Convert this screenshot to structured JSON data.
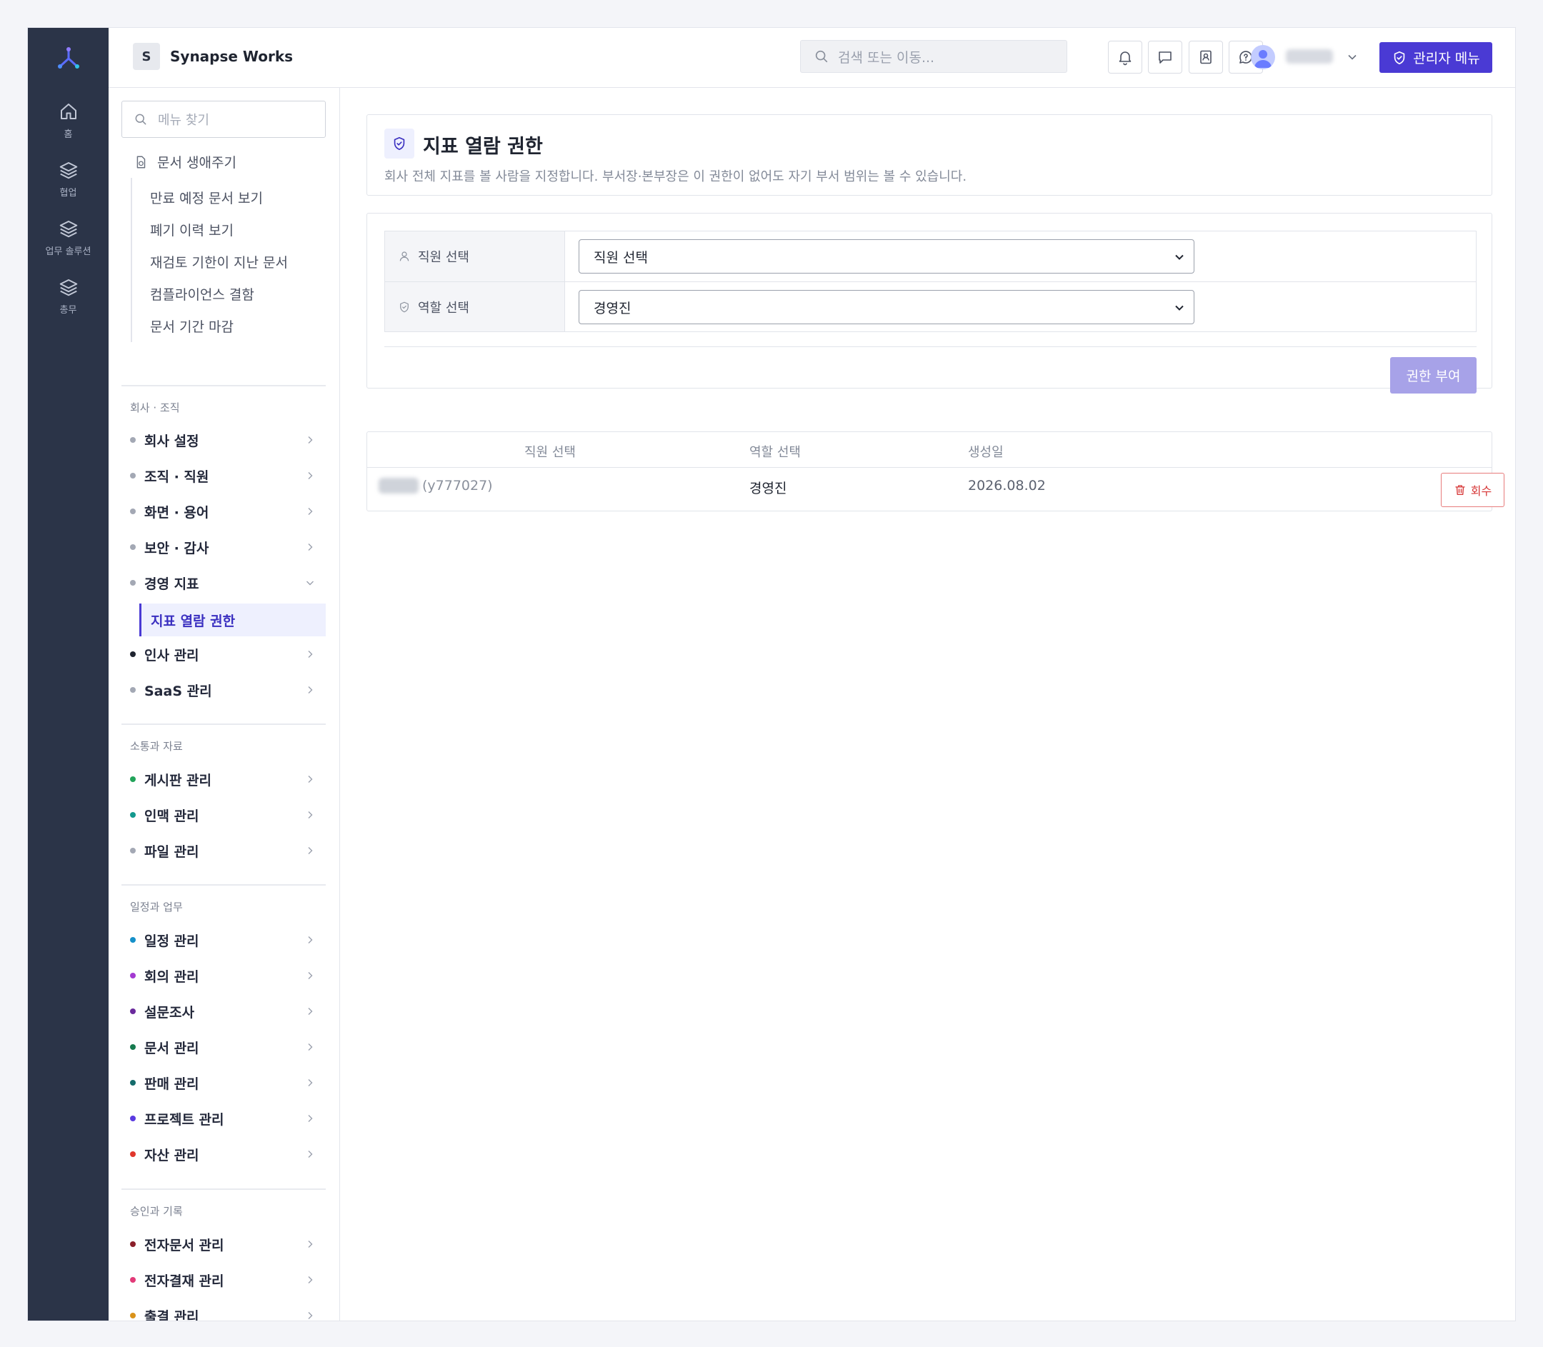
{
  "app": {
    "workspace_initial": "S",
    "workspace_name": "Synapse Works"
  },
  "colors": {
    "rail_bg": "#2b3448",
    "accent": "#4a3ad4",
    "danger": "#d63535",
    "page_bg": "#f4f5f9"
  },
  "rail": {
    "items": [
      {
        "label": "홈",
        "icon": "home-icon"
      },
      {
        "label": "협업",
        "icon": "layers-icon"
      },
      {
        "label": "업무 솔루션",
        "icon": "layers-icon"
      },
      {
        "label": "총무",
        "icon": "layers-icon"
      }
    ]
  },
  "topbar": {
    "search_placeholder": "검색 또는 이동...",
    "admin_label": "관리자 메뉴"
  },
  "sidemenu": {
    "search_placeholder": "메뉴 찾기",
    "lifecycle": {
      "label": "문서 생애주기",
      "children": [
        "만료 예정 문서 보기",
        "폐기 이력 보기",
        "재검토 기한이 지난 문서",
        "컴플라이언스 결함",
        "문서 기간 마감"
      ]
    },
    "sections": [
      {
        "title": "회사 · 조직",
        "items": [
          {
            "label": "회사 설정",
            "dot": "#a3a8b4"
          },
          {
            "label": "조직 · 직원",
            "dot": "#a3a8b4"
          },
          {
            "label": "화면 · 용어",
            "dot": "#a3a8b4"
          },
          {
            "label": "보안 · 감사",
            "dot": "#a3a8b4"
          },
          {
            "label": "경영 지표",
            "dot": "#a3a8b4"
          },
          {
            "label": "인사 관리",
            "dot": "#1f2430"
          },
          {
            "label": "SaaS 관리",
            "dot": "#a3a8b4"
          }
        ],
        "active_child": "지표 열람 권한"
      },
      {
        "title": "소통과 자료",
        "items": [
          {
            "label": "게시판 관리",
            "dot": "#22a35a"
          },
          {
            "label": "인맥 관리",
            "dot": "#13998e"
          },
          {
            "label": "파일 관리",
            "dot": "#a3a8b4"
          }
        ]
      },
      {
        "title": "일정과 업무",
        "items": [
          {
            "label": "일정 관리",
            "dot": "#1590c9"
          },
          {
            "label": "회의 관리",
            "dot": "#a33ad1"
          },
          {
            "label": "설문조사",
            "dot": "#6a2a9c"
          },
          {
            "label": "문서 관리",
            "dot": "#167a4e"
          },
          {
            "label": "판매 관리",
            "dot": "#146b6b"
          },
          {
            "label": "프로젝트 관리",
            "dot": "#5a3ae0"
          },
          {
            "label": "자산 관리",
            "dot": "#e0362c"
          }
        ]
      },
      {
        "title": "승인과 기록",
        "items": [
          {
            "label": "전자문서 관리",
            "dot": "#8b1f2a"
          },
          {
            "label": "전자결재 관리",
            "dot": "#e23a78"
          },
          {
            "label": "출결 관리",
            "dot": "#d9921a"
          }
        ]
      }
    ]
  },
  "page": {
    "title": "지표 열람 권한",
    "description": "회사 전체 지표를 볼 사람을 지정합니다. 부서장·본부장은 이 권한이 없어도 자기 부서 범위는 볼 수 있습니다.",
    "form": {
      "employee_label": "직원 선택",
      "employee_value": "직원 선택",
      "role_label": "역할 선택",
      "role_value": "경영진",
      "grant_button": "권한 부여"
    },
    "table": {
      "headers": [
        "직원 선택",
        "역할 선택",
        "생성일"
      ],
      "rows": [
        {
          "user_id": "(y777027)",
          "role": "경영진",
          "created": "2026.08.02",
          "action": "회수"
        }
      ]
    }
  }
}
